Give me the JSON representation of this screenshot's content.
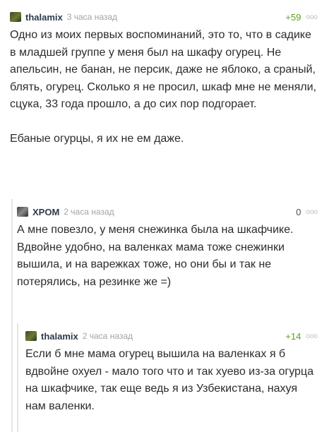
{
  "comments": [
    {
      "username": "thalamix",
      "time": "3 часа назад",
      "rating": "+59",
      "menu": "ooo",
      "body": "Одно из моих первых воспоминаний, это то, что в садике в младшей группе у меня был на шкафу огурец. Не апельсин, не банан, не персик, даже не яблоко, а сраный, блять, огурец. Сколько я не просил, шкаф мне не меняли, сцука, 33 года прошло, а до сих пор подгорает.\n\nЕбаные огурцы, я их не ем даже."
    },
    {
      "username": "XPOM",
      "time": "2 часа назад",
      "rating": "0",
      "menu": "ooo",
      "body": "А мне повезло, у меня снежинка была на шкафчике. Вдвойне удобно, на валенках мама тоже снежинки вышила, и на варежках тоже, но они бы и так не потерялись, на резинке же =)"
    },
    {
      "username": "thalamix",
      "time": "2 часа назад",
      "rating": "+14",
      "menu": "ooo",
      "body": "Если б мне мама огурец вышила на валенках я б вдвойне охуел - мало того что и так хуево из-за огурца на шкафчике, так еще ведь я из Узбекистана, нахуя нам валенки."
    }
  ],
  "colors": {
    "positive": "#5a9f1e",
    "username": "#2b3a4a",
    "muted": "#a3a3a3"
  }
}
